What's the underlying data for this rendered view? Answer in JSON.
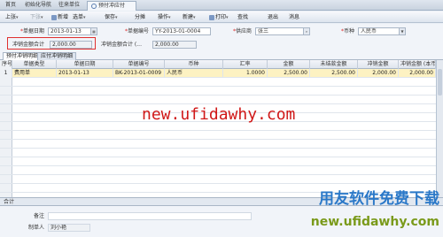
{
  "tabs": [
    {
      "label": "首页"
    },
    {
      "label": "初始化导航"
    },
    {
      "label": "往来单位"
    },
    {
      "label": "预付冲应付"
    }
  ],
  "toolbar": {
    "items": [
      {
        "label": "上张",
        "enabled": true
      },
      {
        "label": "下张",
        "enabled": false
      },
      {
        "label": "新增",
        "enabled": true
      },
      {
        "label": "选单",
        "enabled": true
      },
      {
        "label": "保存",
        "enabled": true
      },
      {
        "label": "分摊",
        "enabled": true
      },
      {
        "label": "操作",
        "enabled": true
      },
      {
        "label": "新建",
        "enabled": true
      },
      {
        "label": "打印",
        "enabled": true
      },
      {
        "label": "查找",
        "enabled": true
      },
      {
        "label": "退出",
        "enabled": true
      },
      {
        "label": "消息",
        "enabled": true
      }
    ]
  },
  "form": {
    "date_label": "单据日期",
    "date_value": "2013-01-13",
    "doc_no_label": "单据编号",
    "doc_no_value": "YY-2013-01-0004",
    "supplier_label": "供应商",
    "supplier_value": "张三",
    "currency_label": "币种",
    "currency_value": "人民币",
    "offset_total_label": "冲销金额合计",
    "offset_total_value": "2,000.00",
    "offset_total2_label": "冲销金额合计 (...",
    "offset_total2_value": "2,000.00"
  },
  "subtabs": [
    {
      "label": "预付冲销明细"
    },
    {
      "label": "应付冲销明细"
    }
  ],
  "grid": {
    "headers": [
      "序号",
      "单据类型",
      "单据日期",
      "单据编号",
      "币种",
      "汇率",
      "金额",
      "未结款金额",
      "冲销金额",
      "冲销金额 (本币)"
    ],
    "rows": [
      [
        "1",
        "费用单",
        "2013-01-13",
        "BK-2013-01-0009",
        "人民币",
        "1.0000",
        "2,500.00",
        "2,500.00",
        "2,000.00",
        "2,000.00"
      ]
    ]
  },
  "totals": {
    "label": "合计"
  },
  "footer": {
    "remark_label": "备注",
    "maker_label": "制单人",
    "maker_value": "刘小艳"
  },
  "watermarks": {
    "url_text": "new.ufidawhy.com",
    "brand_text": "用友软件免费下载",
    "url_text2": "new.ufidawhy.com"
  },
  "colors": {
    "selected_row": "#fdf2c2",
    "highlight_box": "#e03030",
    "watermark_red": "#d01818",
    "watermark_blue": "#2a78c8",
    "watermark_green": "#7a9a1a"
  }
}
